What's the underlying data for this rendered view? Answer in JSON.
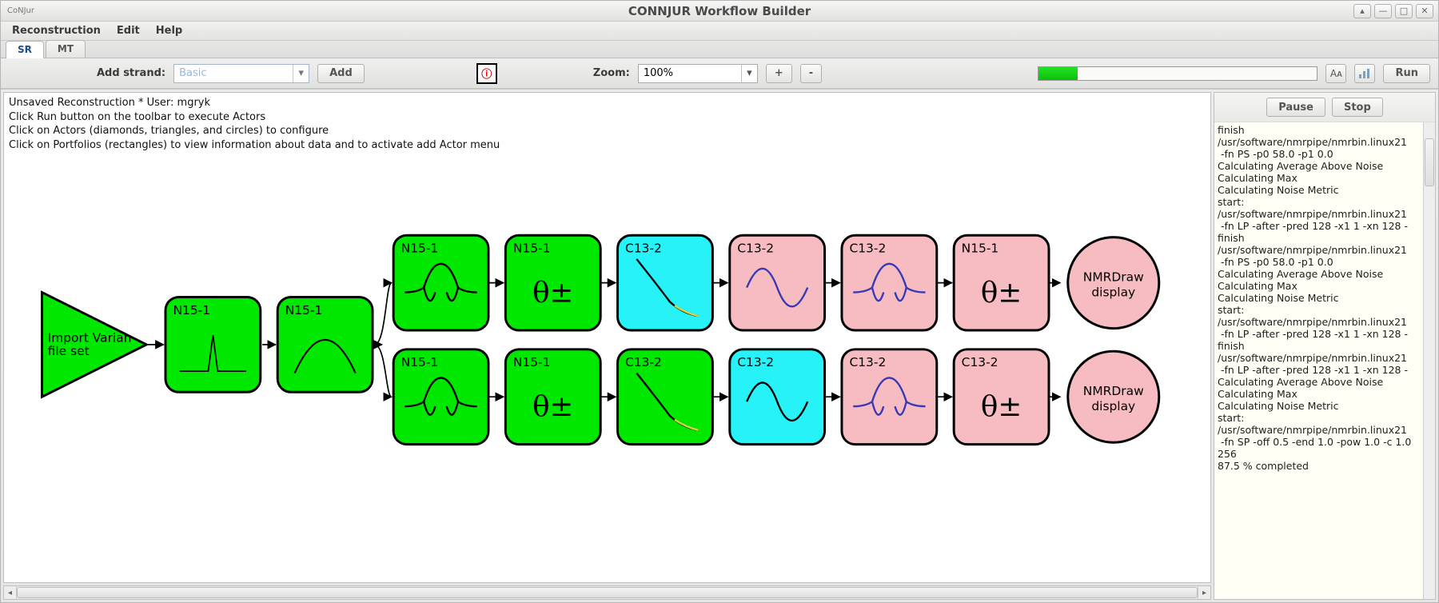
{
  "window": {
    "brand": "CoNJur",
    "title": "CONNJUR Workflow Builder"
  },
  "menu": {
    "items": [
      "Reconstruction",
      "Edit",
      "Help"
    ]
  },
  "tabs": {
    "items": [
      "SR",
      "MT"
    ],
    "active": 0
  },
  "toolbar": {
    "add_strand_label": "Add strand:",
    "strand_combo_value": "Basic",
    "add_button": "Add",
    "zoom_label": "Zoom:",
    "zoom_value": "100%",
    "zoom_in": "+",
    "zoom_out": "-",
    "font_button": "Aᴀ",
    "run_button": "Run"
  },
  "instructions": "Unsaved Reconstruction * User: mgryk\nClick Run button on the toolbar to execute Actors\nClick on Actors (diamonds, triangles, and circles) to configure\nClick on Portfolios (rectangles) to view information about data and to activate add Actor menu",
  "sidepanel": {
    "pause_button": "Pause",
    "stop_button": "Stop"
  },
  "log_lines": [
    "finish",
    "/usr/software/nmrpipe/nmrbin.linux21",
    " -fn PS -p0 58.0 -p1 0.0",
    "Calculating Average Above Noise",
    "Calculating Max",
    "Calculating Noise Metric",
    "start:",
    "/usr/software/nmrpipe/nmrbin.linux21",
    " -fn LP -after -pred 128 -x1 1 -xn 128 -",
    "finish",
    "/usr/software/nmrpipe/nmrbin.linux21",
    " -fn PS -p0 58.0 -p1 0.0",
    "Calculating Average Above Noise",
    "Calculating Max",
    "Calculating Noise Metric",
    "start:",
    "/usr/software/nmrpipe/nmrbin.linux21",
    " -fn LP -after -pred 128 -x1 1 -xn 128 -",
    "finish",
    "/usr/software/nmrpipe/nmrbin.linux21",
    " -fn LP -after -pred 128 -x1 1 -xn 128 -",
    "Calculating Average Above Noise",
    "Calculating Max",
    "Calculating Noise Metric",
    "start:",
    "/usr/software/nmrpipe/nmrbin.linux21",
    " -fn SP -off 0.5 -end 1.0 -pow 1.0 -c 1.0",
    "256",
    "87.5 % completed"
  ],
  "flow": {
    "source": {
      "label1": "Import Varian",
      "label2": "file set"
    },
    "portfolios_head": [
      {
        "label": "N15-1",
        "color": "#00e800",
        "glyph": "spike"
      },
      {
        "label": "N15-1",
        "color": "#00e800",
        "glyph": "peak"
      }
    ],
    "rows": [
      [
        {
          "label": "N15-1",
          "color": "#00e800",
          "glyph": "wave"
        },
        {
          "label": "N15-1",
          "color": "#00e800",
          "glyph": "theta"
        },
        {
          "label": "C13-2",
          "color": "#26f2f8",
          "glyph": "decay"
        },
        {
          "label": "C13-2",
          "color": "#f6bcc1",
          "glyph": "sine"
        },
        {
          "label": "C13-2",
          "color": "#f6bcc1",
          "glyph": "wave"
        },
        {
          "label": "N15-1",
          "color": "#f6bcc1",
          "glyph": "theta"
        }
      ],
      [
        {
          "label": "N15-1",
          "color": "#00e800",
          "glyph": "wave"
        },
        {
          "label": "N15-1",
          "color": "#00e800",
          "glyph": "theta"
        },
        {
          "label": "C13-2",
          "color": "#00e800",
          "glyph": "decay"
        },
        {
          "label": "C13-2",
          "color": "#26f2f8",
          "glyph": "sine"
        },
        {
          "label": "C13-2",
          "color": "#f6bcc1",
          "glyph": "wave"
        },
        {
          "label": "C13-2",
          "color": "#f6bcc1",
          "glyph": "theta"
        }
      ]
    ],
    "sink": {
      "label1": "NMRDraw",
      "label2": "display"
    }
  }
}
